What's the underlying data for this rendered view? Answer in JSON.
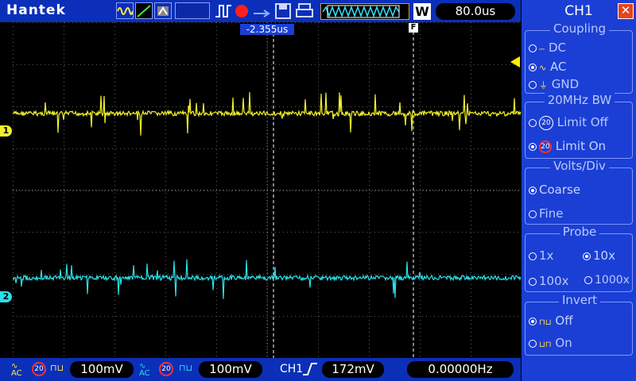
{
  "brand": "Hantek",
  "topbar": {
    "timebase": "80.0us",
    "window_mode": "W",
    "trigger_position": "-2.355us",
    "trigger_marker": "F"
  },
  "channel_markers": {
    "ch1": "1",
    "ch2": "2"
  },
  "panel": {
    "title": "CH1",
    "close_glyph": "✕",
    "coupling": {
      "heading": "Coupling",
      "options": [
        "DC",
        "AC",
        "GND"
      ],
      "selected": "AC"
    },
    "bandwidth": {
      "heading": "20MHz BW",
      "options": [
        "Limit Off",
        "Limit On"
      ],
      "selected": "Limit On"
    },
    "volts_div": {
      "heading": "Volts/Div",
      "options": [
        "Coarse",
        "Fine"
      ],
      "selected": "Coarse"
    },
    "probe": {
      "heading": "Probe",
      "options": [
        "1x",
        "10x",
        "100x",
        "1000x"
      ],
      "selected": "10x"
    },
    "invert": {
      "heading": "Invert",
      "options": [
        "Off",
        "On"
      ],
      "selected": "Off"
    }
  },
  "bottombar": {
    "ch1_scale": "100mV",
    "ch2_scale": "100mV",
    "trigger_source": "CH1",
    "trigger_level": "172mV",
    "frequency": "0.00000Hz",
    "ch1_coupling_badge": "AC",
    "ch2_coupling_badge": "AC",
    "bw_badge": "20"
  },
  "colors": {
    "ch1": "#f2f22a",
    "ch2": "#2ae0e8",
    "panel": "#1b3fd4",
    "bar": "#0b2fb8"
  }
}
